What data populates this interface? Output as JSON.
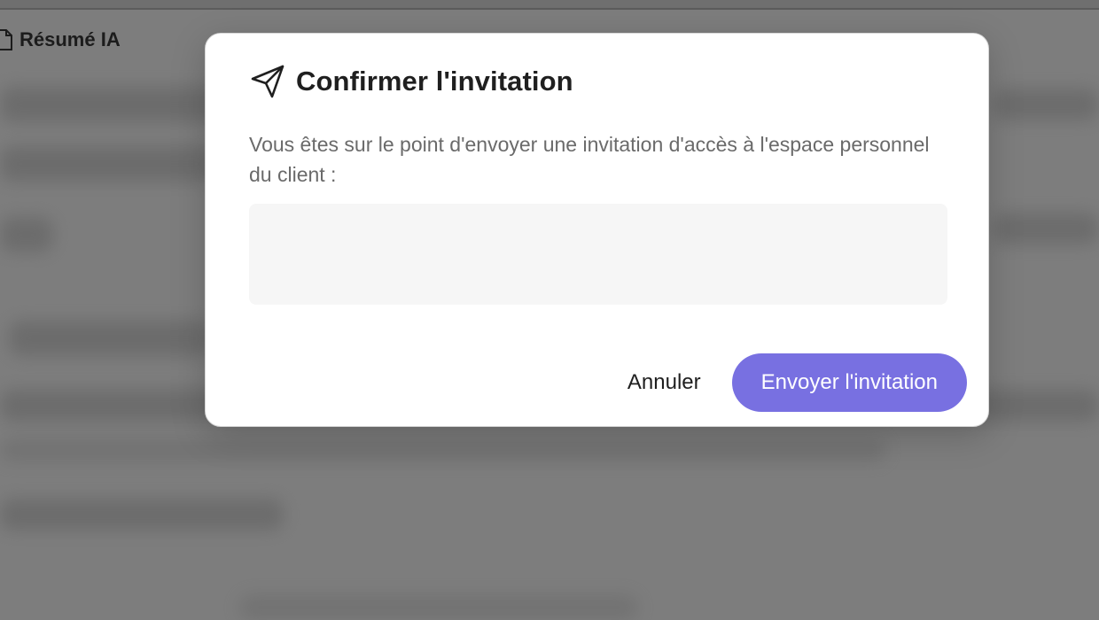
{
  "background": {
    "tab_label": "Résumé IA"
  },
  "modal": {
    "title": "Confirmer l'invitation",
    "description": "Vous êtes sur le point d'envoyer une invitation d'accès à l'espace personnel du client :",
    "client": {
      "name": "",
      "email": ""
    },
    "cancel_label": "Annuler",
    "confirm_label": "Envoyer l'invitation"
  },
  "colors": {
    "accent": "#7870e1",
    "overlay": "#808080",
    "card_bg": "#f6f6f6"
  },
  "icons": {
    "title_icon": "paper-plane-icon",
    "tab_icon": "document-icon"
  }
}
